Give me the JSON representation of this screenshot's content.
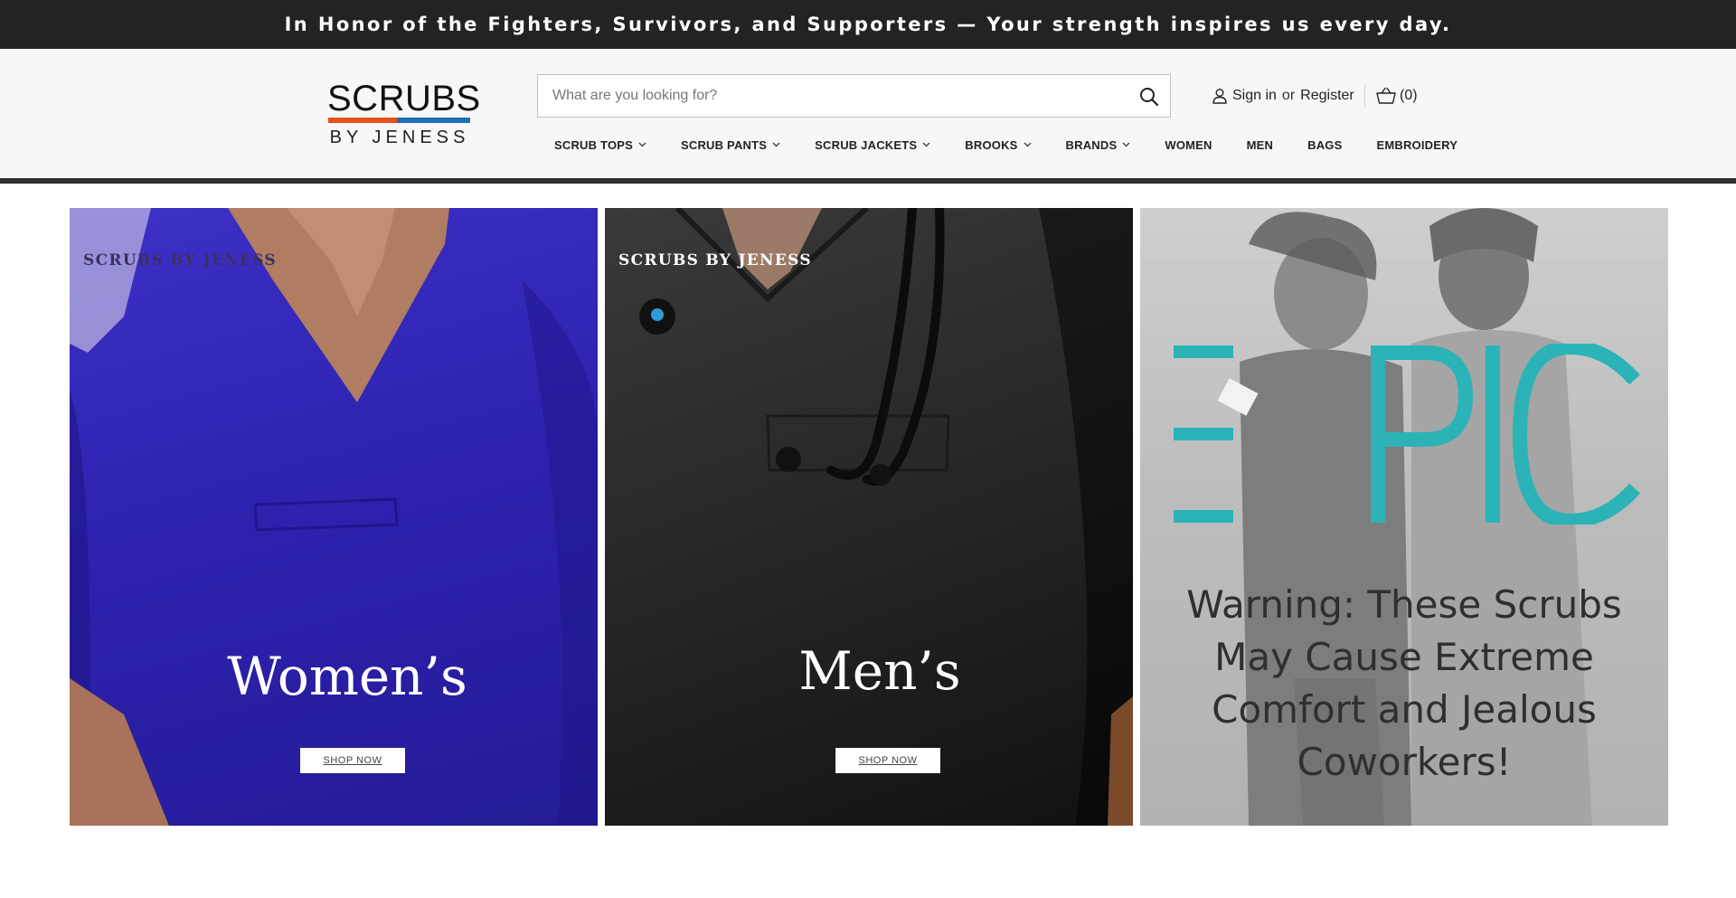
{
  "announcement": "In Honor of the Fighters, Survivors, and Supporters — Your strength inspires us every day.",
  "logo": {
    "top": "SCRUBS",
    "bottom": "BY JENESS"
  },
  "search": {
    "placeholder": "What are you looking for?",
    "icon": "search-icon"
  },
  "account": {
    "sign_in": "Sign in",
    "or": "or",
    "register": "Register",
    "icon": "user-icon"
  },
  "cart": {
    "count_label": "(0)",
    "icon": "basket-icon"
  },
  "nav": [
    {
      "label": "SCRUB TOPS",
      "has_dropdown": true
    },
    {
      "label": "SCRUB PANTS",
      "has_dropdown": true
    },
    {
      "label": "SCRUB JACKETS",
      "has_dropdown": true
    },
    {
      "label": "BROOKS",
      "has_dropdown": true
    },
    {
      "label": "BRANDS",
      "has_dropdown": true
    },
    {
      "label": "WOMEN",
      "has_dropdown": false
    },
    {
      "label": "MEN",
      "has_dropdown": false
    },
    {
      "label": "BAGS",
      "has_dropdown": false
    },
    {
      "label": "EMBROIDERY",
      "has_dropdown": false
    }
  ],
  "tiles": {
    "women": {
      "brand": "SCRUBS BY JENESS",
      "title": "Women’s",
      "button": "SHOP NOW"
    },
    "men": {
      "brand": "SCRUBS BY JENESS",
      "title": "Men’s",
      "button": "SHOP NOW"
    },
    "epic": {
      "logo_text": "EPIC",
      "text": "Warning: These Scrubs May Cause Extreme Comfort and Jealous Coworkers!"
    }
  },
  "colors": {
    "announcement_bg": "#232323",
    "header_bg": "#f7f7f7",
    "logo_orange": "#e8521f",
    "logo_blue": "#1f6fb8",
    "women_scrub": "#2e22b0",
    "men_scrub": "#262626",
    "epic_teal": "#2bb3b8"
  }
}
